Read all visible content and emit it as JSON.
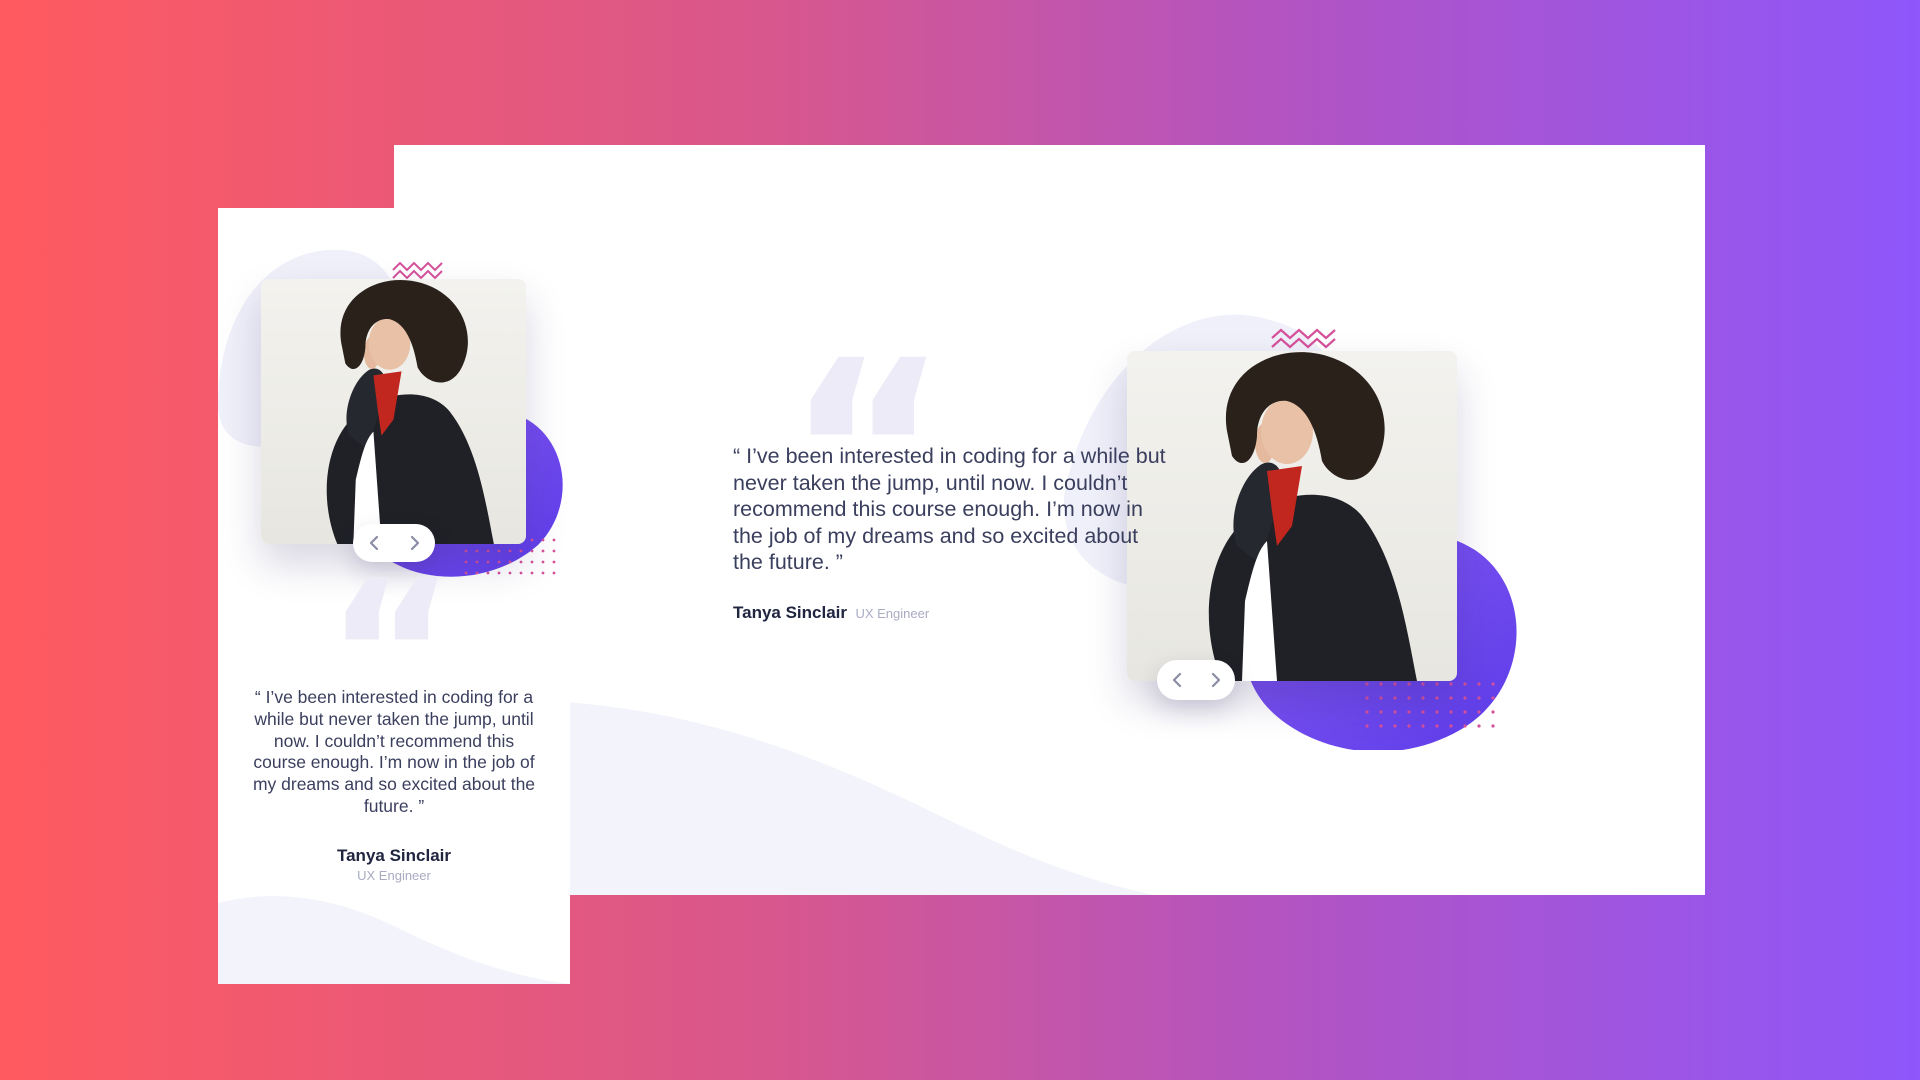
{
  "testimonial": {
    "quote": "“ I’ve been interested in coding for a while but never taken the jump, until now. I couldn’t recommend this course enough. I’m now in the job of my dreams and so excited about the future. ”",
    "author_name": "Tanya Sinclair",
    "author_role": "UX Engineer"
  },
  "icons": {
    "prev": "chevron-left-icon",
    "next": "chevron-right-icon",
    "quote": "quotation-mark-icon",
    "pattern_zigzag": "zigzag-pattern",
    "pattern_dots": "dot-grid-pattern"
  },
  "colors": {
    "gradient_start": "#ff5a5f",
    "gradient_end": "#8e56fb",
    "blob_start": "#8a5cf5",
    "blob_end": "#5b3be8",
    "text_dark": "#202540",
    "text_body": "#3b3f5e",
    "text_muted": "#a9abc3",
    "accent_pink": "#d5519b"
  }
}
